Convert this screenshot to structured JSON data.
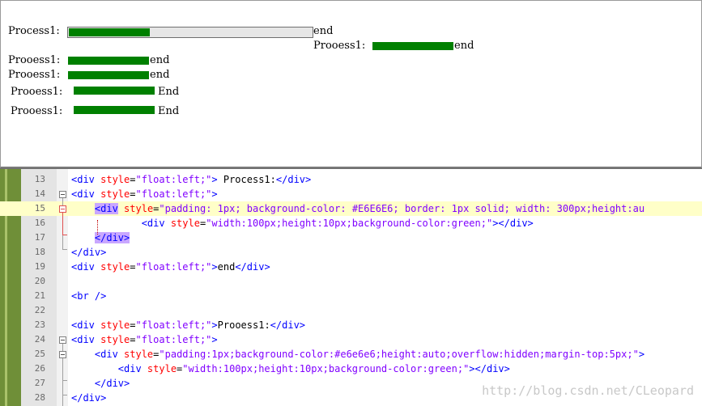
{
  "preview": {
    "rows": [
      {
        "label": "Process1:",
        "end": "end",
        "progress": 0.33
      },
      {
        "label": "Prooess1:",
        "end": "end"
      },
      {
        "label": "Prooess1:",
        "end": "end"
      },
      {
        "label": "Prooess1:",
        "end": "end"
      },
      {
        "label": "Prooess1:",
        "end": "End"
      },
      {
        "label": "Prooess1:",
        "end": "End"
      }
    ]
  },
  "editor": {
    "lines": [
      {
        "n": "13",
        "parts": [
          [
            "t",
            "<div "
          ],
          [
            "a",
            "style"
          ],
          [
            "pl",
            "="
          ],
          [
            "s",
            "\"float:left;\""
          ],
          [
            "t",
            "> "
          ],
          [
            "pl",
            "Process1:"
          ],
          [
            "t",
            "</div>"
          ]
        ]
      },
      {
        "n": "14",
        "parts": [
          [
            "t",
            "<div "
          ],
          [
            "a",
            "style"
          ],
          [
            "pl",
            "="
          ],
          [
            "s",
            "\"float:left;\""
          ],
          [
            "t",
            ">"
          ]
        ]
      },
      {
        "n": "15",
        "parts": [
          [
            "pl",
            "    "
          ],
          [
            "tsel",
            "<div"
          ],
          [
            "pl",
            " "
          ],
          [
            "a",
            "style"
          ],
          [
            "pl",
            "="
          ],
          [
            "s",
            "\"padding: 1px; background-color: #E6E6E6; border: 1px solid; width: 300px;height:au"
          ]
        ]
      },
      {
        "n": "16",
        "parts": [
          [
            "pl",
            "            "
          ],
          [
            "t",
            "<div "
          ],
          [
            "a",
            "style"
          ],
          [
            "pl",
            "="
          ],
          [
            "s",
            "\"width:100px;height:10px;background-color:green;\""
          ],
          [
            "t",
            "></div>"
          ]
        ]
      },
      {
        "n": "17",
        "parts": [
          [
            "pl",
            "    "
          ],
          [
            "tsel",
            "</div>"
          ]
        ]
      },
      {
        "n": "18",
        "parts": [
          [
            "t",
            "</div>"
          ]
        ]
      },
      {
        "n": "19",
        "parts": [
          [
            "t",
            "<div "
          ],
          [
            "a",
            "style"
          ],
          [
            "pl",
            "="
          ],
          [
            "s",
            "\"float:left;\""
          ],
          [
            "t",
            ">"
          ],
          [
            "pl",
            "end"
          ],
          [
            "t",
            "</div>"
          ]
        ]
      },
      {
        "n": "20",
        "parts": []
      },
      {
        "n": "21",
        "parts": [
          [
            "t",
            "<br />"
          ]
        ]
      },
      {
        "n": "22",
        "parts": []
      },
      {
        "n": "23",
        "parts": [
          [
            "t",
            "<div "
          ],
          [
            "a",
            "style"
          ],
          [
            "pl",
            "="
          ],
          [
            "s",
            "\"float:left;\""
          ],
          [
            "t",
            ">"
          ],
          [
            "pl",
            "Prooess1:"
          ],
          [
            "t",
            "</div>"
          ]
        ]
      },
      {
        "n": "24",
        "parts": [
          [
            "t",
            "<div "
          ],
          [
            "a",
            "style"
          ],
          [
            "pl",
            "="
          ],
          [
            "s",
            "\"float:left;\""
          ],
          [
            "t",
            ">"
          ]
        ]
      },
      {
        "n": "25",
        "parts": [
          [
            "pl",
            "    "
          ],
          [
            "t",
            "<div "
          ],
          [
            "a",
            "style"
          ],
          [
            "pl",
            "="
          ],
          [
            "s",
            "\"padding:1px;background-color:#e6e6e6;height:auto;overflow:hidden;margin-top:5px;\""
          ],
          [
            "t",
            ">"
          ]
        ]
      },
      {
        "n": "26",
        "parts": [
          [
            "pl",
            "        "
          ],
          [
            "t",
            "<div "
          ],
          [
            "a",
            "style"
          ],
          [
            "pl",
            "="
          ],
          [
            "s",
            "\"width:100px;height:10px;background-color:green;\""
          ],
          [
            "t",
            "></div>"
          ]
        ]
      },
      {
        "n": "27",
        "parts": [
          [
            "pl",
            "    "
          ],
          [
            "t",
            "</div>"
          ]
        ]
      },
      {
        "n": "28",
        "parts": [
          [
            "t",
            "</div>"
          ]
        ]
      }
    ],
    "watermark": "http://blog.csdn.net/CLeopard"
  }
}
